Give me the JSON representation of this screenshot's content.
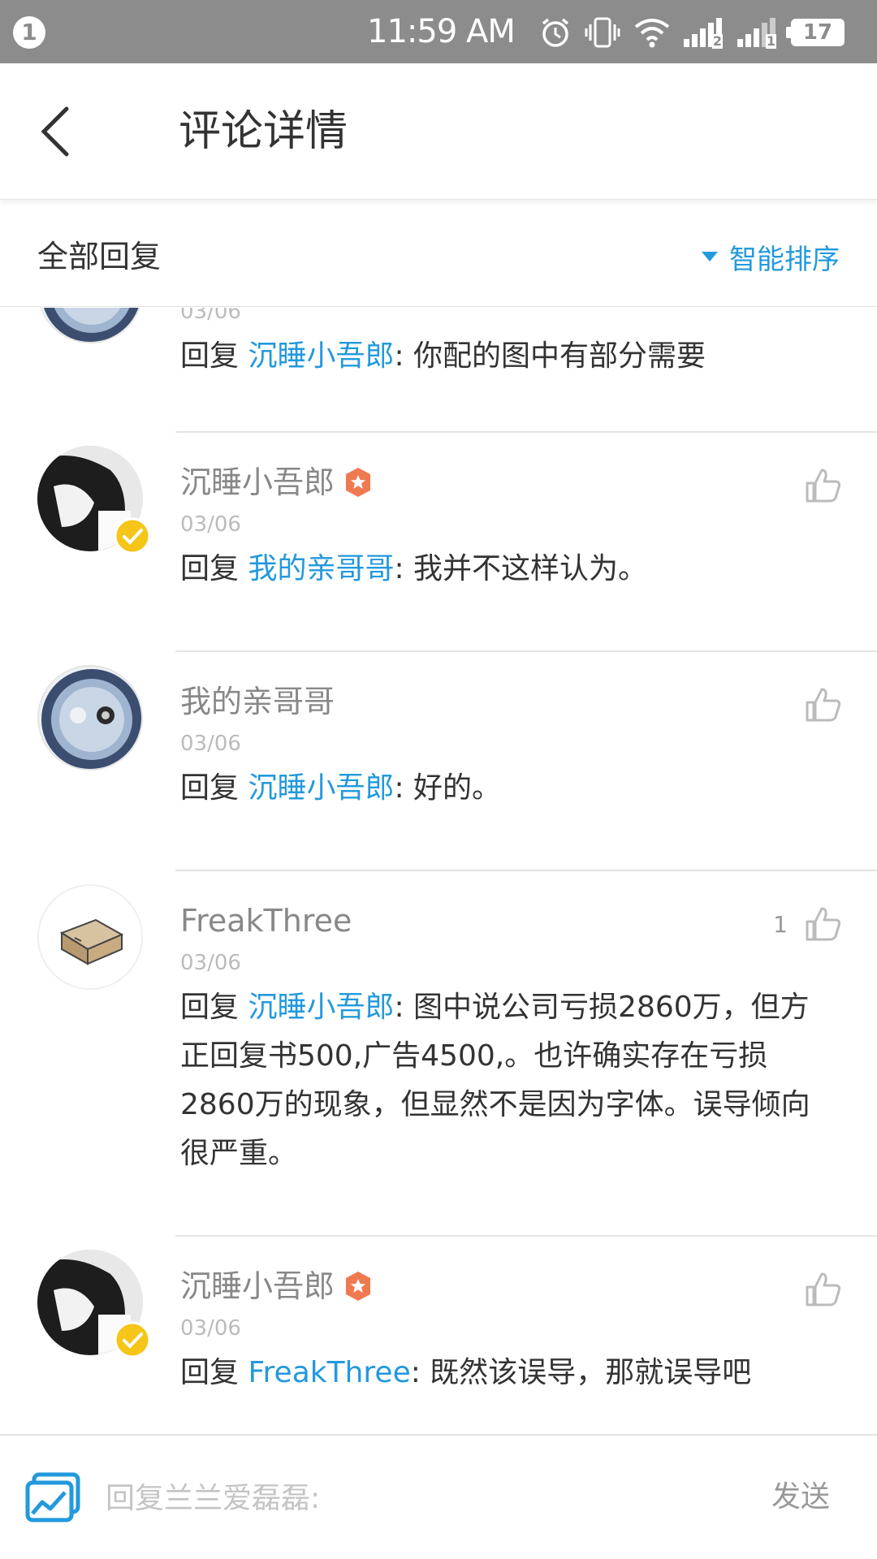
{
  "status_bar": {
    "notification_count": "1",
    "time": "11:59 AM",
    "sim1_label": "2",
    "sim2_label": "1",
    "battery": "17"
  },
  "header": {
    "back_icon": "chevron-left-icon",
    "title": "评论详情"
  },
  "subheader": {
    "all_replies": "全部回复",
    "sort_label": "智能排序"
  },
  "comments": [
    {
      "username": "",
      "date": "03/06",
      "reply_prefix": "回复 ",
      "mention": "沉睡小吾郎",
      "text": ": 你配的图中有部分需要",
      "likes": ""
    },
    {
      "username": "沉睡小吾郎",
      "date": "03/06",
      "reply_prefix": "回复 ",
      "mention": "我的亲哥哥",
      "text": ": 我并不这样认为。",
      "likes": ""
    },
    {
      "username": "我的亲哥哥",
      "date": "03/06",
      "reply_prefix": "回复 ",
      "mention": "沉睡小吾郎",
      "text": ": 好的。",
      "likes": ""
    },
    {
      "username": "FreakThree",
      "date": "03/06",
      "reply_prefix": "回复 ",
      "mention": "沉睡小吾郎",
      "text": ": 图中说公司亏损2860万，但方正回复书500,广告4500,。也许确实存在亏损2860万的现象，但显然不是因为字体。误导倾向很严重。",
      "likes": "1"
    },
    {
      "username": "沉睡小吾郎",
      "date": "03/06",
      "reply_prefix": "回复 ",
      "mention": "FreakThree",
      "text": ": 既然该误导，那就误导吧",
      "likes": ""
    }
  ],
  "bottom_bar": {
    "placeholder": "回复兰兰爱磊磊:",
    "send_label": "发送"
  },
  "colors": {
    "accent": "#2299dd",
    "status_bar": "#8c8c8c",
    "level_badge": "#ef7a52",
    "verified_badge": "#f5c518"
  }
}
